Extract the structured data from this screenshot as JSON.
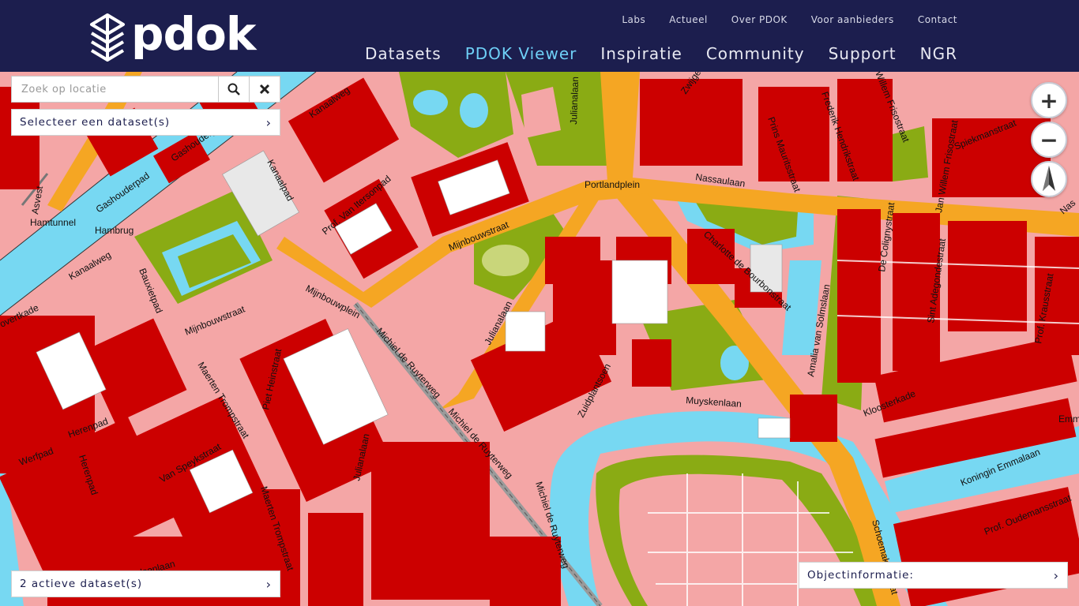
{
  "brand": {
    "logo_text": "pdok"
  },
  "top_nav": [
    "Labs",
    "Actueel",
    "Over PDOK",
    "Voor aanbieders",
    "Contact"
  ],
  "main_nav": [
    "Datasets",
    "PDOK Viewer",
    "Inspiratie",
    "Community",
    "Support",
    "NGR"
  ],
  "active_main_nav": "PDOK Viewer",
  "search": {
    "placeholder": "Zoek op locatie",
    "value": ""
  },
  "search_icon": "search-icon",
  "clear_icon": "close-icon",
  "dataset_select": {
    "label": "Selecteer een dataset(s)"
  },
  "active_datasets": {
    "label": "2 actieve dataset(s)"
  },
  "object_info": {
    "label": "Objectinformatie:"
  },
  "map_controls": {
    "zoom_in": "+",
    "zoom_out": "−",
    "north": "north-arrow-icon"
  },
  "colors": {
    "header": "#1c1e4e",
    "active_nav": "#6ecff6",
    "building": "#cc0000",
    "paving": "#f4a6a6",
    "road_main": "#f5a623",
    "water": "#77d8f2",
    "green": "#8aab14"
  },
  "street_labels": [
    "Kanaalweg",
    "Gashouderpad",
    "Gashouderpad",
    "Kanaalpad",
    "Asvest",
    "Hamtunnel",
    "Hambrug",
    "Kanaalweg",
    "Bauxietpad",
    "Mijnbouwstraat",
    "Mijnbouwstraat",
    "Mijnbouwplein",
    "Prof. Van Itersonpad",
    "Julianalaan",
    "Portlandplein",
    "Nassaulaan",
    "Prins Mauritsstraat",
    "Frederik Hendrikstraat",
    "Willem Frisostraat",
    "Jan Willem Frisostraat",
    "Spiekmanstraat",
    "Charlotte de Bourbonstraat",
    "Amalia van Solmslaan",
    "De Colignystraat",
    "Sint Adegondestraat",
    "Prof. Krausstraat",
    "Julianalaan",
    "Michiel de Ruyterweg",
    "Michiel de Ruyterweg",
    "Michiel de Ruyterweg",
    "Zuidplantsoen",
    "Muyskenlaan",
    "Kloosterkade",
    "Koningin Emmalaan",
    "Prof. Oudemansstraat",
    "Schoemakerstraat",
    "Piet Heinstraat",
    "Maerten Trompstraat",
    "Maerten Trompstraat",
    "Van Speykstraat",
    "Herenpad",
    "Herenpad",
    "Werfpad",
    "Van Malsenlaan",
    "Julianalaan",
    "Zwijgerstraat",
    "overtkade",
    "Emm",
    "Nas"
  ]
}
